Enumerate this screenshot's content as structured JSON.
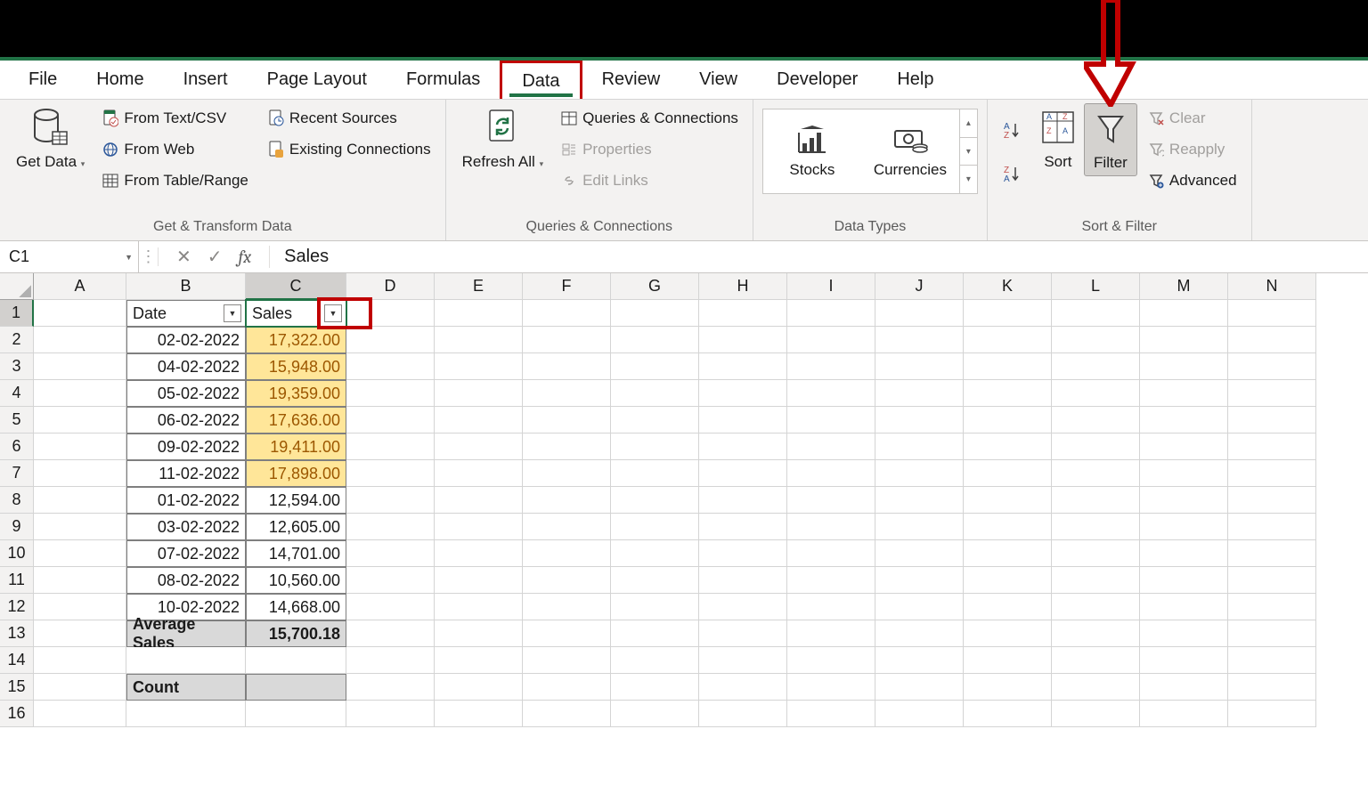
{
  "tabs": {
    "file": "File",
    "home": "Home",
    "insert": "Insert",
    "page_layout": "Page Layout",
    "formulas": "Formulas",
    "data": "Data",
    "review": "Review",
    "view": "View",
    "developer": "Developer",
    "help": "Help",
    "active": "data"
  },
  "ribbon": {
    "get_transform": {
      "label": "Get & Transform Data",
      "get_data": "Get\nData",
      "from_text": "From Text/CSV",
      "from_web": "From Web",
      "from_table": "From Table/Range",
      "recent": "Recent Sources",
      "existing": "Existing Connections"
    },
    "queries": {
      "label": "Queries & Connections",
      "refresh": "Refresh\nAll",
      "qc": "Queries & Connections",
      "props": "Properties",
      "edit_links": "Edit Links"
    },
    "data_types": {
      "label": "Data Types",
      "stocks": "Stocks",
      "currencies": "Currencies"
    },
    "sort_filter": {
      "label": "Sort & Filter",
      "sort": "Sort",
      "filter": "Filter",
      "clear": "Clear",
      "reapply": "Reapply",
      "advanced": "Advanced"
    }
  },
  "namebox": "C1",
  "formula": "Sales",
  "columns": [
    "A",
    "B",
    "C",
    "D",
    "E",
    "F",
    "G",
    "H",
    "I",
    "J",
    "K",
    "L",
    "M",
    "N"
  ],
  "rows": [
    1,
    2,
    3,
    4,
    5,
    6,
    7,
    8,
    9,
    10,
    11,
    12,
    13,
    14,
    15,
    16
  ],
  "table": {
    "headers": {
      "b": "Date",
      "c": "Sales"
    },
    "data": [
      {
        "date": "02-02-2022",
        "sales": "17,322.00",
        "hl": true
      },
      {
        "date": "04-02-2022",
        "sales": "15,948.00",
        "hl": true
      },
      {
        "date": "05-02-2022",
        "sales": "19,359.00",
        "hl": true
      },
      {
        "date": "06-02-2022",
        "sales": "17,636.00",
        "hl": true
      },
      {
        "date": "09-02-2022",
        "sales": "19,411.00",
        "hl": true
      },
      {
        "date": "11-02-2022",
        "sales": "17,898.00",
        "hl": true
      },
      {
        "date": "01-02-2022",
        "sales": "12,594.00",
        "hl": false
      },
      {
        "date": "03-02-2022",
        "sales": "12,605.00",
        "hl": false
      },
      {
        "date": "07-02-2022",
        "sales": "14,701.00",
        "hl": false
      },
      {
        "date": "08-02-2022",
        "sales": "10,560.00",
        "hl": false
      },
      {
        "date": "10-02-2022",
        "sales": "14,668.00",
        "hl": false
      }
    ],
    "avg_label": "Average Sales",
    "avg_value": "15,700.18",
    "count_label": "Count"
  }
}
